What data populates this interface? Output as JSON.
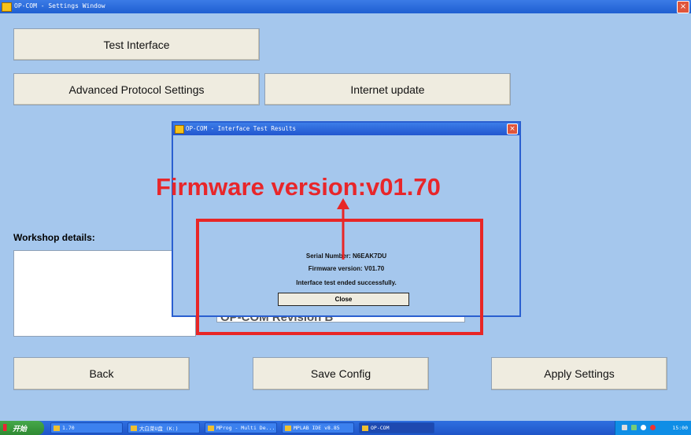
{
  "window": {
    "title": "OP-COM - Settings Window",
    "close": "×"
  },
  "buttons": {
    "test_interface": "Test Interface",
    "advanced_protocol": "Advanced Protocol Settings",
    "internet_update": "Internet update",
    "back": "Back",
    "save_config": "Save Config",
    "apply_settings": "Apply Settings"
  },
  "workshop": {
    "label": "Workshop details:",
    "value": ""
  },
  "underlay_dropdown": {
    "value": "OP-COM Revision B"
  },
  "dialog": {
    "title": "OP-COM - Interface Test Results",
    "close": "×",
    "serial": "Serial Number: N6EAK7DU",
    "firmware": "Firmware version: V01.70",
    "status": "Interface test ended successfully.",
    "close_button": "Close"
  },
  "annotation": {
    "text": "Firmware version:v01.70",
    "color": "#e8262a"
  },
  "taskbar": {
    "start": "开始",
    "tasks": [
      "1.70",
      "大白菜U盘 (K:)",
      "MProg - Multi De...",
      "MPLAB IDE v8.85",
      "OP-COM"
    ],
    "clock": "15:00"
  },
  "colors": {
    "background": "#a5c7ed",
    "titlebar": "#2a62d6",
    "annotation": "#e8262a"
  }
}
